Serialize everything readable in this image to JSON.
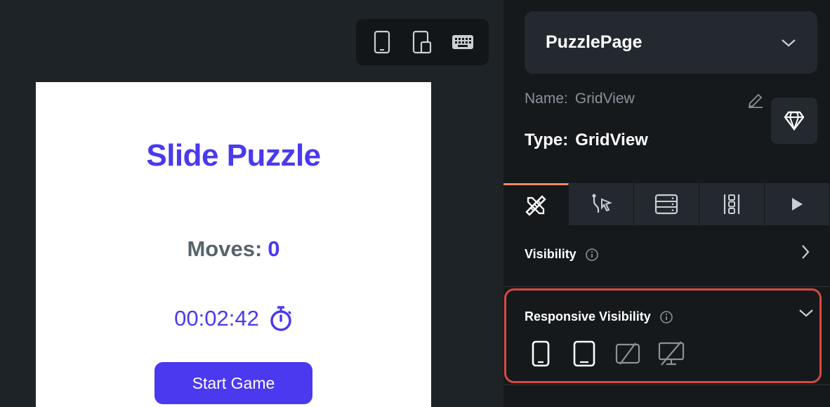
{
  "device_toolbar": {
    "items": [
      "phone-icon",
      "tablet-icon",
      "keyboard-icon"
    ]
  },
  "preview": {
    "title": "Slide Puzzle",
    "moves_label": "Moves:",
    "moves_count": "0",
    "timer": "00:02:42",
    "start_button": "Start Game"
  },
  "panel": {
    "page_name": "PuzzlePage",
    "name_label": "Name:",
    "name_value": "GridView",
    "type_label": "Type:",
    "type_value": "GridView",
    "tabs": [
      "properties-tab",
      "actions-tab",
      "backend-query-tab",
      "layout-tab",
      "run-tab"
    ],
    "visibility_label": "Visibility",
    "responsive_visibility_label": "Responsive Visibility",
    "responsive_options": [
      {
        "device": "phone",
        "visible": true
      },
      {
        "device": "tablet",
        "visible": true
      },
      {
        "device": "tablet-landscape",
        "visible": false
      },
      {
        "device": "desktop",
        "visible": false
      }
    ]
  },
  "colors": {
    "accent": "#4b39ef",
    "highlight": "#d9483b",
    "tab_active": "#ee8b60"
  }
}
